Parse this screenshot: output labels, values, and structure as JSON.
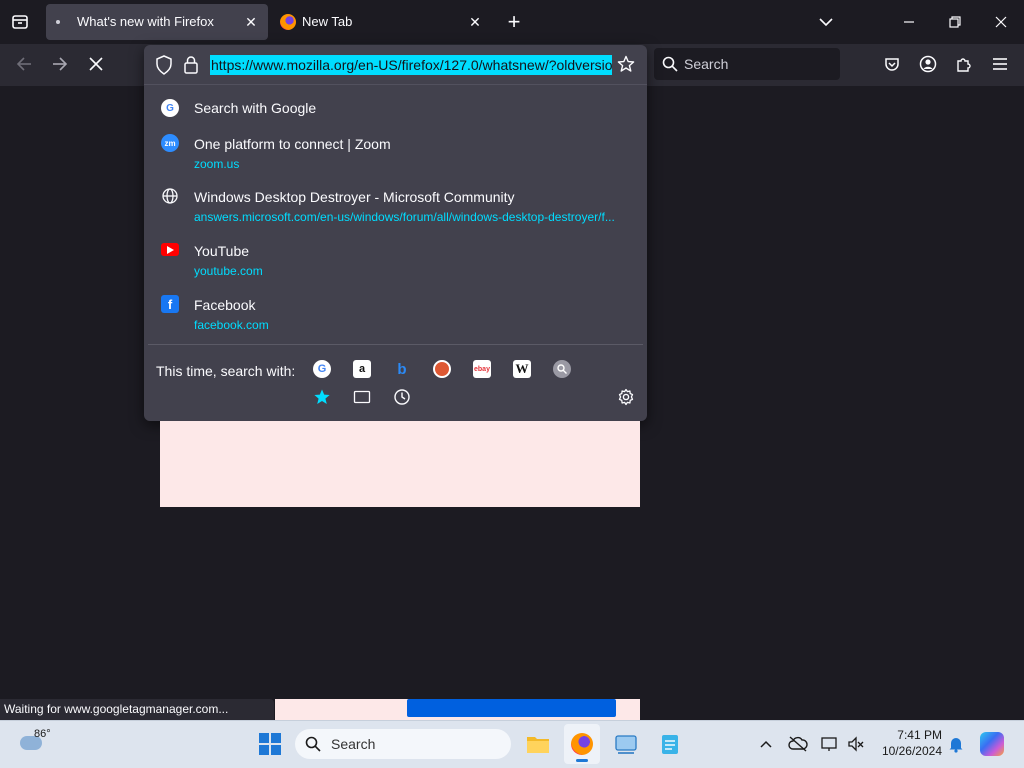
{
  "tabs": [
    {
      "title": "What's new with Firefox"
    },
    {
      "title": "New Tab"
    }
  ],
  "navbar": {
    "url": "https://www.mozilla.org/en-US/firefox/127.0/whatsnew/?oldversio",
    "search_placeholder": "Search"
  },
  "suggestions": [
    {
      "title": "Search with Google",
      "url": "",
      "favicon": "google-icon"
    },
    {
      "title": "One platform to connect | Zoom",
      "url": "zoom.us",
      "favicon": "zoom-icon"
    },
    {
      "title": "Windows Desktop Destroyer - Microsoft Community",
      "url": "answers.microsoft.com/en-us/windows/forum/all/windows-desktop-destroyer/f...",
      "favicon": "globe-icon"
    },
    {
      "title": "YouTube",
      "url": "youtube.com",
      "favicon": "youtube-icon"
    },
    {
      "title": "Facebook",
      "url": "facebook.com",
      "favicon": "facebook-icon"
    }
  ],
  "oneoff": {
    "label": "This time, search with:",
    "engines": [
      "google-icon",
      "amazon-icon",
      "bing-icon",
      "duckduckgo-icon",
      "ebay-icon",
      "wikipedia-icon",
      "search-engine-icon"
    ],
    "engine_letters": [
      "G",
      "a",
      "b",
      "",
      "ebay",
      "W",
      ""
    ],
    "shortcuts": [
      "bookmarks-star-icon",
      "tabs-icon",
      "history-icon"
    ]
  },
  "status": "Waiting for www.googletagmanager.com...",
  "taskbar": {
    "weather_temp": "86°",
    "search_placeholder": "Search",
    "time": "7:41 PM",
    "date": "10/26/2024"
  },
  "colors": {
    "accent": "#00ddff",
    "popup_bg": "#42414d",
    "toolbar_bg": "#2b2a33",
    "tabstrip_bg": "#1c1b22",
    "taskbar_bg": "#dde4ee",
    "page_pink": "#fde8e8",
    "button_blue": "#0060df"
  }
}
